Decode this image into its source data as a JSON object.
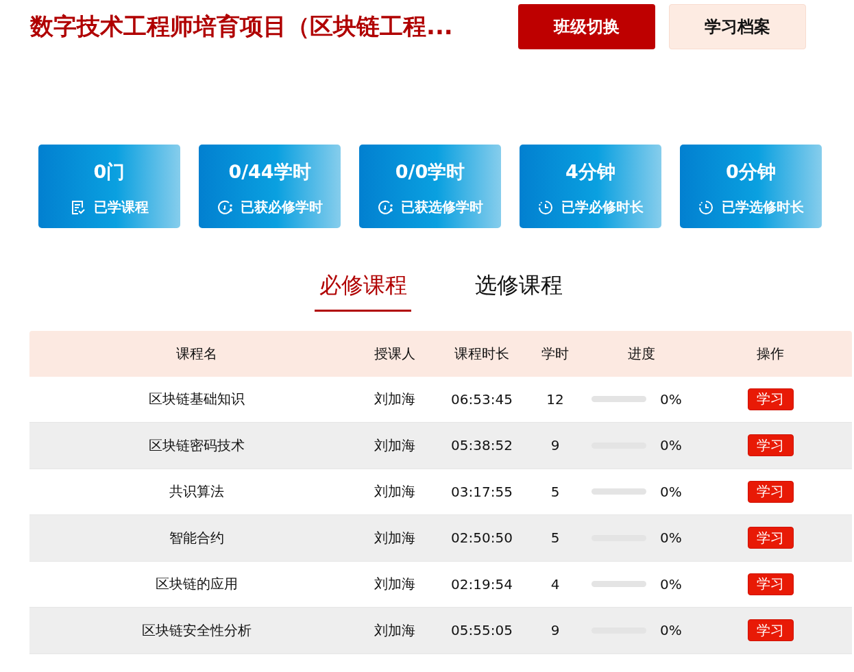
{
  "header": {
    "title": "数字技术工程师培育项目（区块链工程...",
    "buttons": [
      {
        "label": "班级切换",
        "kind": "primary"
      },
      {
        "label": "学习档案",
        "kind": "secondary"
      }
    ]
  },
  "stats": [
    {
      "value": "0门",
      "label": "已学课程"
    },
    {
      "value": "0/44学时",
      "label": "已获必修学时"
    },
    {
      "value": "0/0学时",
      "label": "已获选修学时"
    },
    {
      "value": "4分钟",
      "label": "已学必修时长"
    },
    {
      "value": "0分钟",
      "label": "已学选修时长"
    }
  ],
  "tabs": [
    {
      "label": "必修课程",
      "selected": true
    },
    {
      "label": "选修课程",
      "selected": false
    }
  ],
  "table": {
    "columns": [
      "课程名",
      "授课人",
      "课程时长",
      "学时",
      "进度",
      "操作"
    ],
    "rows": [
      {
        "name": "区块链基础知识",
        "teacher": "刘加海",
        "duration": "06:53:45",
        "hours": "12",
        "level": 0,
        "reading": "0%",
        "action": "学习"
      },
      {
        "name": "区块链密码技术",
        "teacher": "刘加海",
        "duration": "05:38:52",
        "hours": "9",
        "level": 0,
        "reading": "0%",
        "action": "学习"
      },
      {
        "name": "共识算法",
        "teacher": "刘加海",
        "duration": "03:17:55",
        "hours": "5",
        "level": 0,
        "reading": "0%",
        "action": "学习"
      },
      {
        "name": "智能合约",
        "teacher": "刘加海",
        "duration": "02:50:50",
        "hours": "5",
        "level": 0,
        "reading": "0%",
        "action": "学习"
      },
      {
        "name": "区块链的应用",
        "teacher": "刘加海",
        "duration": "02:19:54",
        "hours": "4",
        "level": 0,
        "reading": "0%",
        "action": "学习"
      },
      {
        "name": "区块链安全性分析",
        "teacher": "刘加海",
        "duration": "05:55:05",
        "hours": "9",
        "level": 0,
        "reading": "0%",
        "action": "学习"
      }
    ]
  }
}
